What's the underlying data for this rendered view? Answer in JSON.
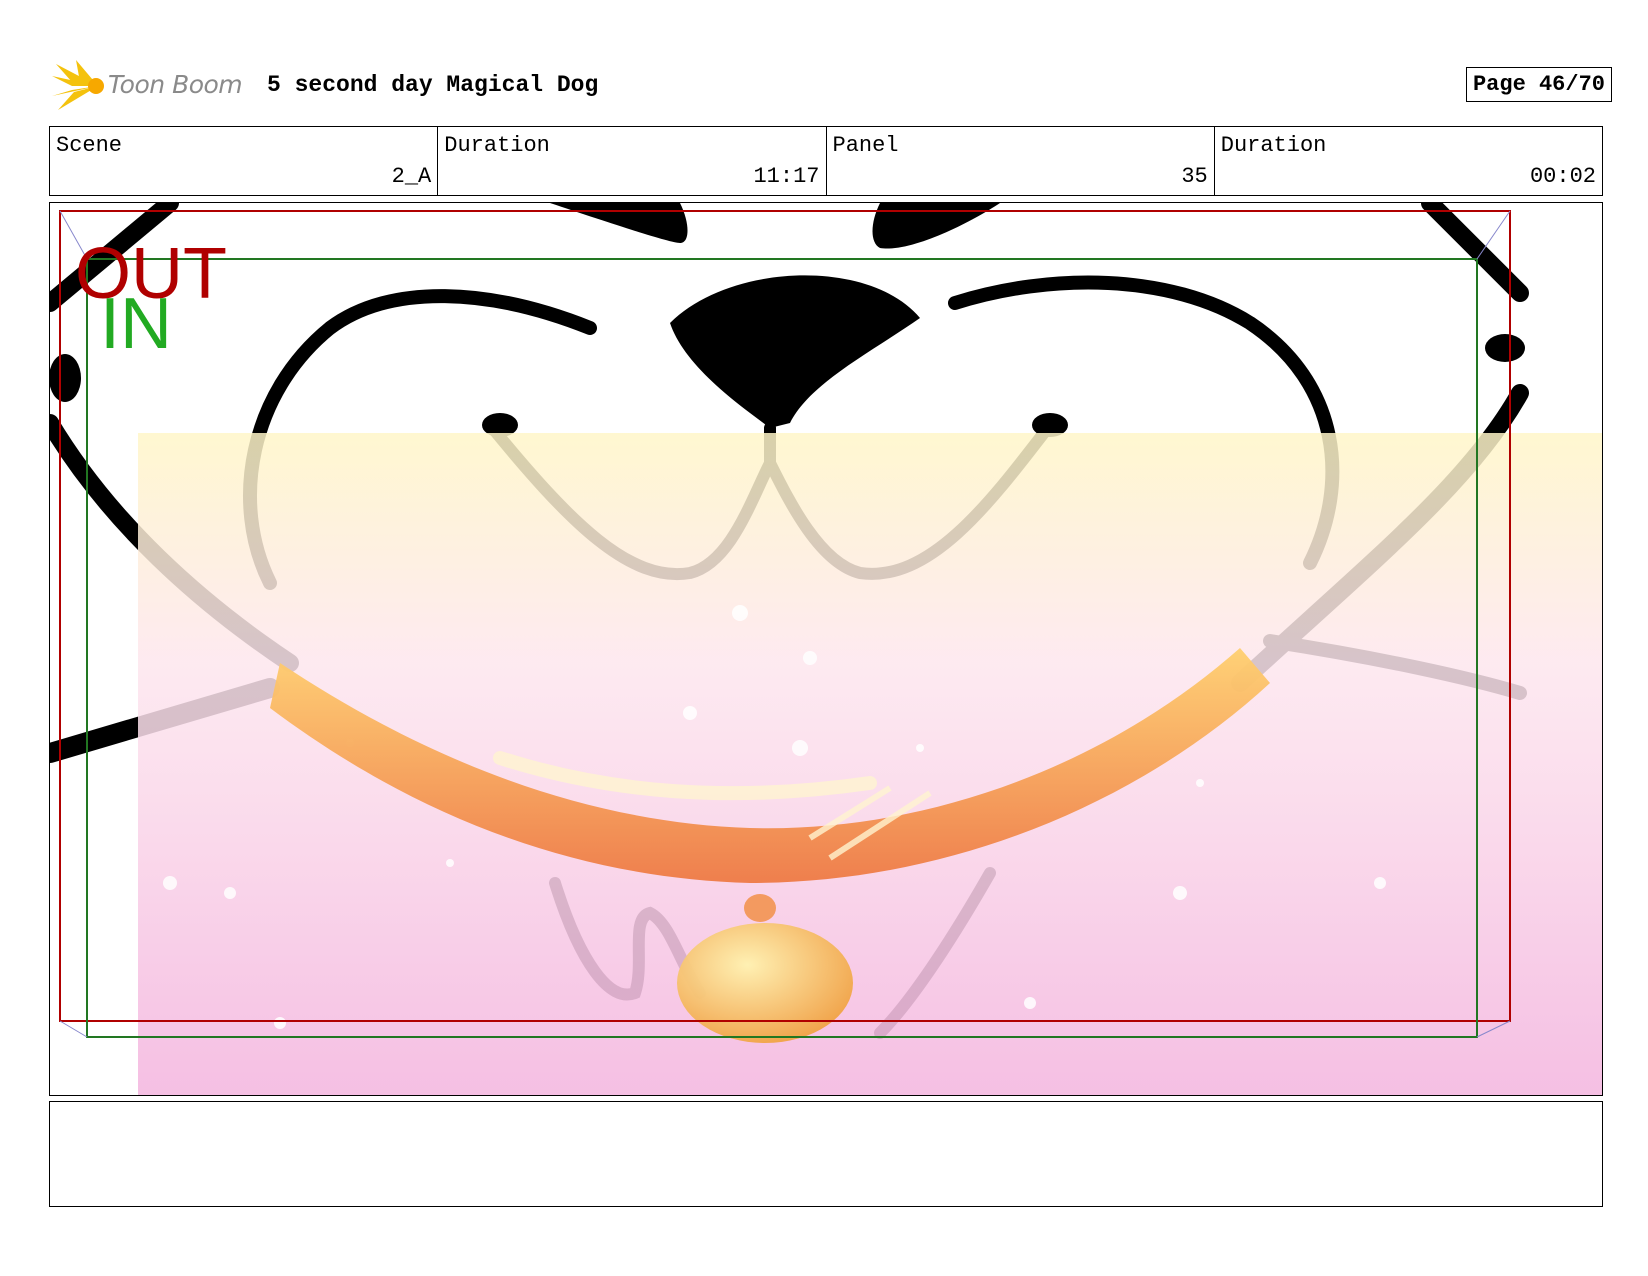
{
  "header": {
    "logo_text": "Toon Boom",
    "project_title": "5 second day Magical Dog",
    "page_label": "Page 46/70"
  },
  "info": {
    "scene_label": "Scene",
    "scene_value": "2_A",
    "scene_duration_label": "Duration",
    "scene_duration_value": "11:17",
    "panel_label": "Panel",
    "panel_value": "35",
    "panel_duration_label": "Duration",
    "panel_duration_value": "00:02"
  },
  "frame_marks": {
    "out_label": "OUT",
    "in_label": "IN",
    "out_color": "#b00000",
    "in_color": "#22aa22"
  },
  "artwork": {
    "icon": "dog-face-closeup-collar-icon",
    "description_colors": {
      "collar": "#f5a347",
      "glow_pink": "#f4b8e0",
      "glow_yellow": "#fff6c8"
    }
  },
  "notes": {
    "text": ""
  }
}
